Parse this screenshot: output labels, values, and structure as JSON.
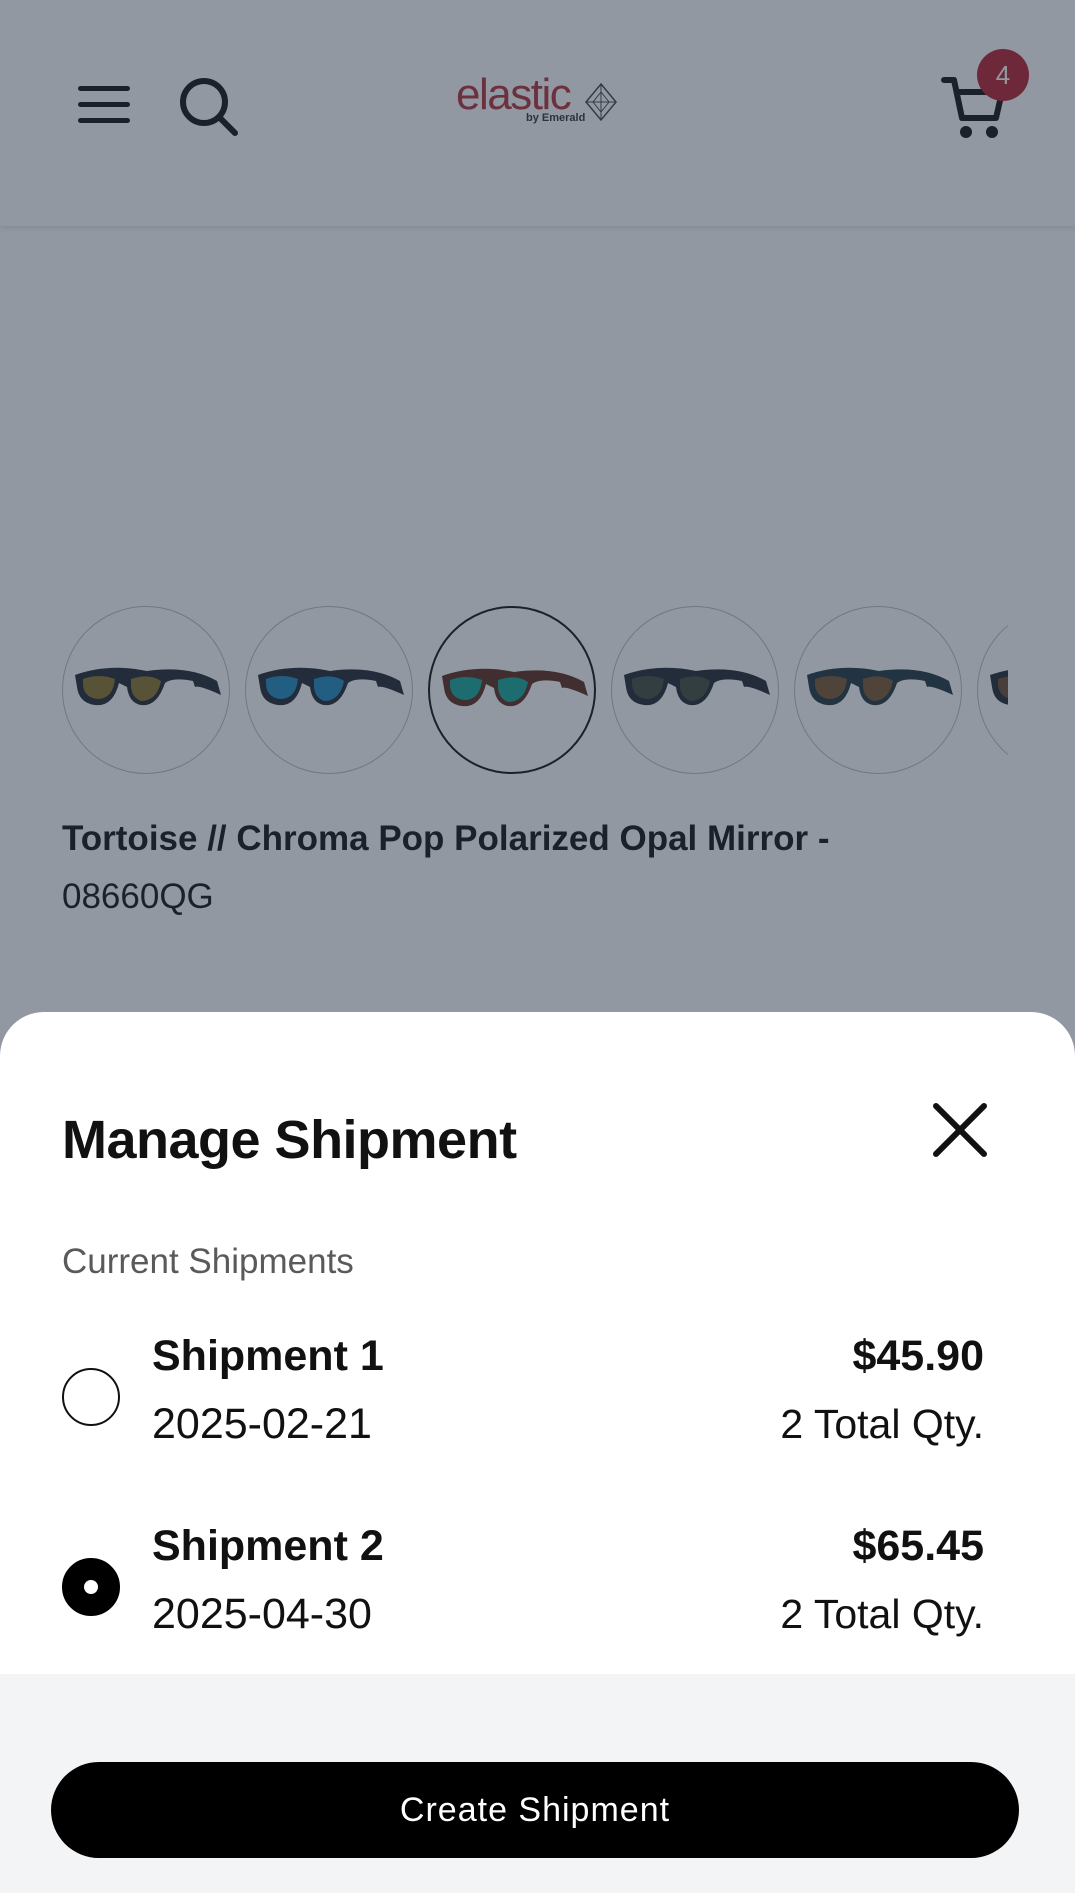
{
  "header": {
    "logo_text": "elastic",
    "logo_subtext": "by Emerald",
    "cart_count": "4",
    "menu_icon": "hamburger-menu-icon",
    "search_icon": "search-icon",
    "cart_icon": "shopping-cart-icon"
  },
  "product": {
    "variant_name": "Tortoise // Chroma Pop Polarized Opal Mirror -",
    "sku": "08660QG",
    "swatches": [
      {
        "lens_color": "#8a7228",
        "frame_color": "#1f2630",
        "selected": false
      },
      {
        "lens_color": "#1f88c0",
        "frame_color": "#1f2630",
        "selected": false
      },
      {
        "lens_color": "#14a89c",
        "frame_color": "#5a2a1e",
        "selected": true
      },
      {
        "lens_color": "#3f4a3c",
        "frame_color": "#1f2630",
        "selected": false
      },
      {
        "lens_color": "#7a5430",
        "frame_color": "#1f3440",
        "selected": false
      },
      {
        "lens_color": "#6a4a30",
        "frame_color": "#1f2630",
        "selected": false
      }
    ]
  },
  "sheet": {
    "title": "Manage Shipment",
    "section_label": "Current Shipments",
    "shipments": [
      {
        "name": "Shipment 1",
        "date": "2025-02-21",
        "price": "$45.90",
        "qty": "2 Total Qty.",
        "selected": false
      },
      {
        "name": "Shipment 2",
        "date": "2025-04-30",
        "price": "$65.45",
        "qty": "2 Total Qty.",
        "selected": true
      }
    ],
    "create_button": "Create Shipment"
  },
  "colors": {
    "brand_red": "#b03038",
    "badge_red": "#b5202e",
    "primary_button": "#000000"
  }
}
